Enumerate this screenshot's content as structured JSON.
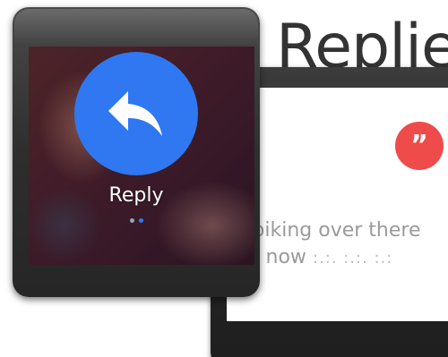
{
  "heading": {
    "text": "Replie"
  },
  "back_watch": {
    "badge_icon": "quote-icon",
    "badge_glyph": "”",
    "badge_color": "#ef4b4b",
    "message_line_1": "m biking over there",
    "message_line_2": "ght now",
    "message_scribble": ":.:. :.:. :.:"
  },
  "front_watch": {
    "action_icon": "reply-arrow-icon",
    "action_color": "#2f78f2",
    "action_label": "Reply",
    "pager": {
      "count": 2,
      "active_index": 1
    }
  }
}
